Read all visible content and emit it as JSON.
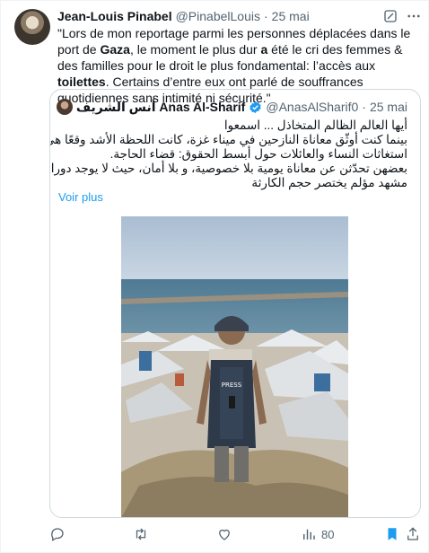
{
  "tweet": {
    "display_name": "Jean-Louis Pinabel",
    "handle": "@PinabelLouis",
    "separator": "·",
    "date": "25 mai",
    "text_segments": [
      {
        "t": "\"Lors de mon reportage parmi les personnes déplacées dans le port de ",
        "bold": false
      },
      {
        "t": "Gaza",
        "bold": true
      },
      {
        "t": ", le moment le plus dur ",
        "bold": false
      },
      {
        "t": "a",
        "bold": true
      },
      {
        "t": " été le cri des femmes & des familles pour le droit le plus fondamental: l’accès aux ",
        "bold": false
      },
      {
        "t": "toilettes",
        "bold": true
      },
      {
        "t": ". Certains d’entre eux ont parlé de souffrances quotidiennes sans intimité ni sécurité.\"",
        "bold": false
      }
    ]
  },
  "quote": {
    "display_name": "أنس الشريف Anas Al-Sharif",
    "handle": "@AnasAlSharif0",
    "separator": "·",
    "date": "25 mai",
    "lines": [
      "أيها العالم الظالم المتخاذل ... اسمعوا",
      "بينما كنت أوثّق معاناة النازحين في ميناء غزة، كانت اللحظة الأشد وقعًا هي",
      "استغاثات النساء والعائلات حول أبسط الحقوق: قضاء الحاجة.",
      "بعضهن تحدّثن عن معاناة يومية بلا خصوصية، و بلا أمان، حيث لا يوجد دورات مياه",
      "مشهد مؤلم يختصر حجم الكارثة"
    ],
    "voir_plus": "Voir plus",
    "photo_vest_label": "PRESS"
  },
  "actions": {
    "replies": "",
    "reposts": "",
    "likes": "",
    "views": "80"
  },
  "colors": {
    "accent": "#1d9bf0",
    "muted": "#536471",
    "bookmark_active": "#1d9bf0"
  },
  "icons": [
    "grok-icon",
    "more-icon",
    "verified-icon",
    "reply-icon",
    "repost-icon",
    "like-icon",
    "views-icon",
    "bookmark-icon",
    "share-icon"
  ]
}
